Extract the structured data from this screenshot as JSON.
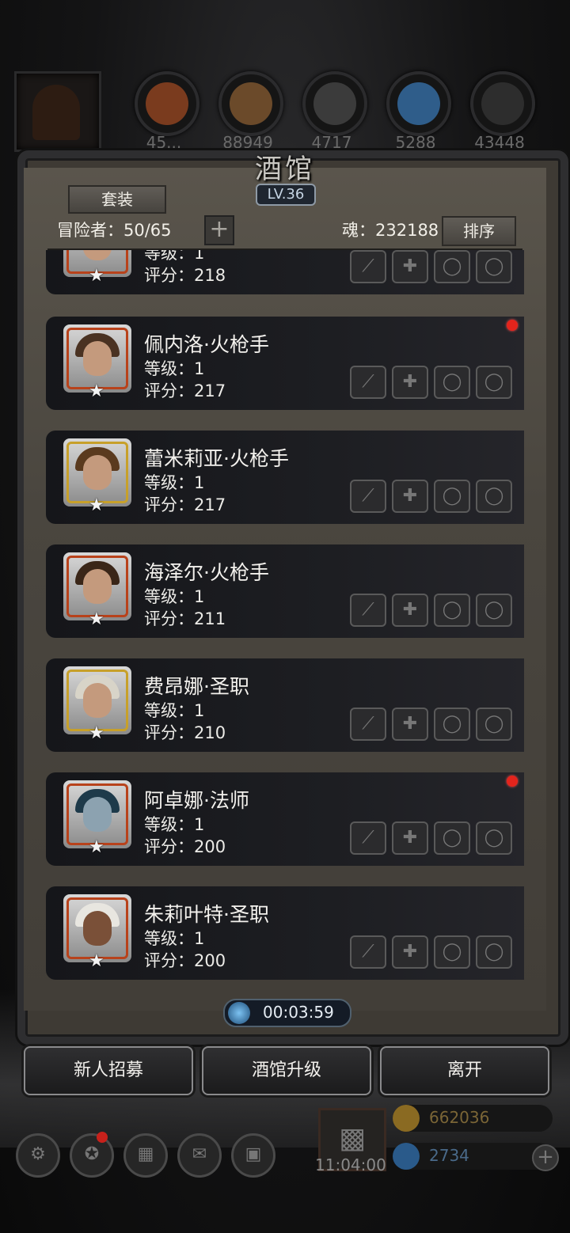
{
  "top_resources": [
    {
      "name": "ore-icon",
      "value": "45...",
      "color": "#7a3b1e"
    },
    {
      "name": "wood-icon",
      "value": "88949",
      "color": "#6b4a2a"
    },
    {
      "name": "iron-icon",
      "value": "4717",
      "color": "#3b3b3b"
    },
    {
      "name": "crystal-icon",
      "value": "5288",
      "color": "#2f5d8a"
    },
    {
      "name": "metal-icon",
      "value": "43448",
      "color": "#2d2d2d"
    }
  ],
  "panel": {
    "title": "酒馆",
    "level": "LV.36",
    "suit_button": "套装",
    "adventurers": "冒险者：50/65",
    "add_label": "+",
    "soul": "魂：232188",
    "sort_button": "排序"
  },
  "heroes": [
    {
      "name": "",
      "level": "等级：1",
      "score": "评分：218",
      "dot": false,
      "frame": "red",
      "hair": "#6b5030"
    },
    {
      "name": "佩内洛·火枪手",
      "level": "等级：1",
      "score": "评分：217",
      "dot": true,
      "frame": "red",
      "hair": "#4a3222"
    },
    {
      "name": "蕾米莉亚·火枪手",
      "level": "等级：1",
      "score": "评分：217",
      "dot": false,
      "frame": "gold",
      "hair": "#5a3a1e"
    },
    {
      "name": "海泽尔·火枪手",
      "level": "等级：1",
      "score": "评分：211",
      "dot": false,
      "frame": "red",
      "hair": "#3a2618"
    },
    {
      "name": "费昂娜·圣职",
      "level": "等级：1",
      "score": "评分：210",
      "dot": false,
      "frame": "gold",
      "hair": "#d8d4c8"
    },
    {
      "name": "阿卓娜·法师",
      "level": "等级：1",
      "score": "评分：200",
      "dot": true,
      "frame": "red",
      "hair": "#1e3a4a"
    },
    {
      "name": "朱莉叶特·圣职",
      "level": "等级：1",
      "score": "评分：200",
      "dot": false,
      "frame": "red",
      "hair": "#e8e6e0"
    }
  ],
  "timer": "00:03:59",
  "buttons": {
    "recruit": "新人招募",
    "upgrade": "酒馆升级",
    "leave": "离开"
  },
  "gift_time": "11:04:00",
  "currency": {
    "gold": "662036",
    "gem": "2734"
  }
}
